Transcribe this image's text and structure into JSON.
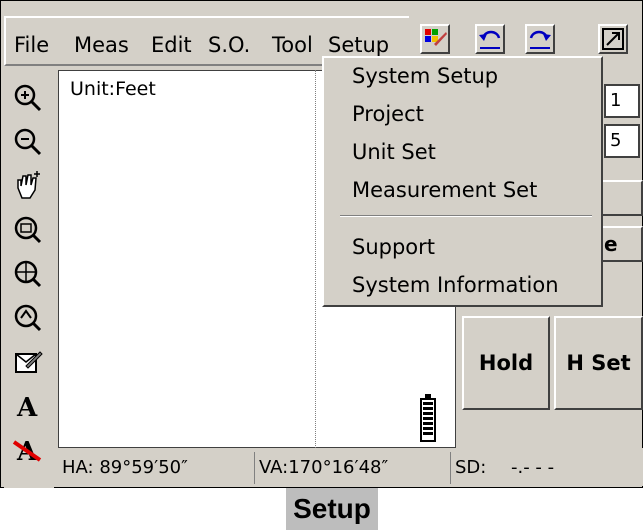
{
  "menubar": {
    "items": [
      "File",
      "Meas",
      "Edit",
      "S.O.",
      "Tool",
      "Setup"
    ]
  },
  "toolbar": {
    "buttons": [
      "color-picker-icon",
      "undo-icon",
      "redo-icon",
      "close-window-icon"
    ]
  },
  "tools": [
    "zoom-in-icon",
    "zoom-out-icon",
    "pan-hand-icon",
    "zoom-window-icon",
    "zoom-extent-icon",
    "zoom-previous-icon",
    "edit-pen-icon",
    "text-icon",
    "no-text-icon"
  ],
  "canvas": {
    "unit_label": "Unit:Feet"
  },
  "setup_menu": {
    "items": [
      "System Setup",
      "Project",
      "Unit Set",
      "Measurement Set"
    ],
    "items2": [
      "Support",
      "System Information"
    ]
  },
  "right_panel": {
    "field1": "1",
    "field2": "5",
    "button_e": "e",
    "hold_label": "Hold",
    "hset_label": "H Set"
  },
  "status": {
    "ha": "HA: 89°59′50″",
    "va": "VA:170°16′48″",
    "sd_label": "SD:",
    "sd_value": "-.- - -"
  },
  "caption": "Setup",
  "colors": {
    "face": "#d4d0c8",
    "caption_bg": "#bdbdbd"
  }
}
